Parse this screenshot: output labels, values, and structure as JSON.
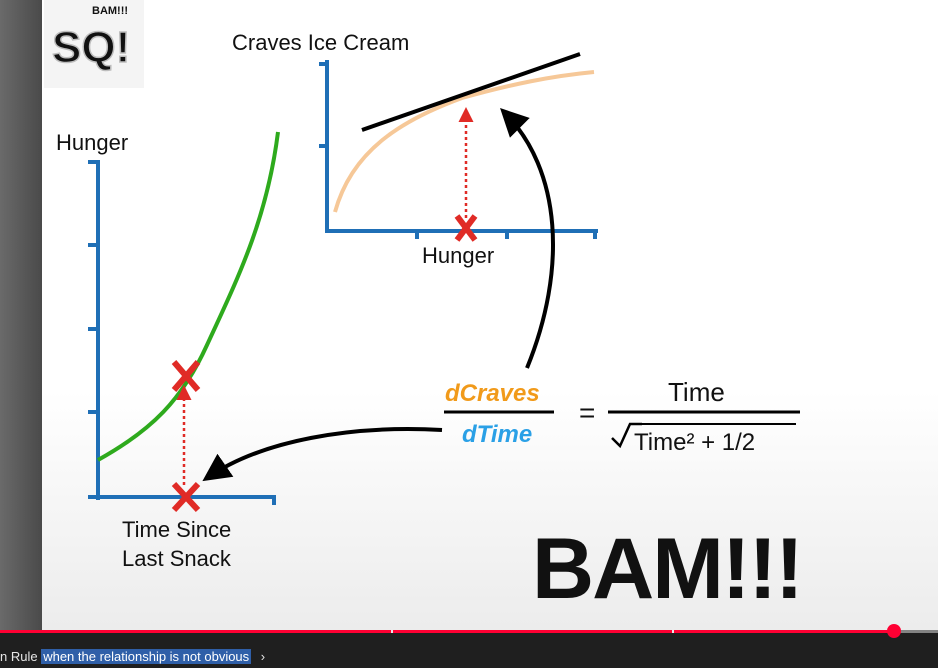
{
  "slide": {
    "logo": {
      "text_top": "BAM!!!",
      "text_main": "SQ!"
    },
    "top_chart": {
      "ylabel": "Craves Ice Cream",
      "xlabel": "Hunger",
      "colors": {
        "axis": "#1f6fb6",
        "curve": "#f6c898",
        "tangent": "#000000",
        "marker": "#e02b26"
      }
    },
    "left_chart": {
      "ylabel": "Hunger",
      "xlabel_line1": "Time Since",
      "xlabel_line2": "Last Snack",
      "colors": {
        "axis": "#1f6fb6",
        "curve": "#2eaa1d",
        "marker": "#e02b26"
      }
    },
    "equation": {
      "numerator_left": "dCraves",
      "denominator_left": "dTime",
      "equals": "=",
      "numerator_right": "Time",
      "denominator_right": "Time² + 1/2",
      "colors": {
        "dcraves": "#f19a1a",
        "dtime": "#2aa0e6"
      }
    },
    "exclaim": "BAM!!!"
  },
  "player": {
    "progress_fraction": 0.953,
    "chapter_marks": [
      0.417,
      0.716
    ],
    "chapter_title_prefix": "n Rule",
    "chapter_title_highlight": "when the relationship is not obvious",
    "chapter_chevron": "›",
    "colors": {
      "progress": "#ff0033"
    }
  }
}
